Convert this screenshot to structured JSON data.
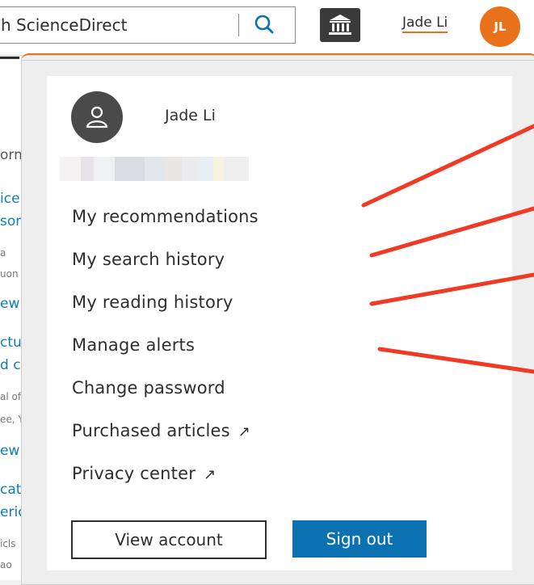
{
  "header": {
    "search_value": "h ScienceDirect",
    "user_name": "Jade Li",
    "avatar_initials": "JL",
    "icons": [
      "search-icon",
      "institution-icon"
    ]
  },
  "background_fragments": [
    {
      "text": "orm",
      "style": "text"
    },
    {
      "text": "ice",
      "style": "link"
    },
    {
      "text": "son",
      "style": "link"
    },
    {
      "text": "a",
      "style": "small"
    },
    {
      "text": "uon",
      "style": "small"
    },
    {
      "text": "ew",
      "style": "link"
    },
    {
      "text": "ctur",
      "style": "link"
    },
    {
      "text": "d cu",
      "style": "link"
    },
    {
      "text": "al of",
      "style": "small"
    },
    {
      "text": "ee, Y",
      "style": "small"
    },
    {
      "text": "ew",
      "style": "link"
    },
    {
      "text": "cat",
      "style": "link"
    },
    {
      "text": "erich",
      "style": "link"
    },
    {
      "text": "icls",
      "style": "small"
    },
    {
      "text": "ao",
      "style": "small"
    }
  ],
  "account_menu": {
    "profile_name": "Jade Li",
    "items": [
      {
        "label": "My recommendations"
      },
      {
        "label": "My search history"
      },
      {
        "label": "My reading history"
      },
      {
        "label": "Manage alerts"
      },
      {
        "label": "Change password"
      },
      {
        "label": "Purchased articles",
        "external": true
      },
      {
        "label": "Privacy center",
        "external": true
      }
    ],
    "view_account_label": "View account",
    "sign_out_label": "Sign out"
  },
  "colors": {
    "accent_orange": "#e9711c",
    "sign_out_blue": "#0c71b0",
    "annotation_red": "#f03a24"
  }
}
